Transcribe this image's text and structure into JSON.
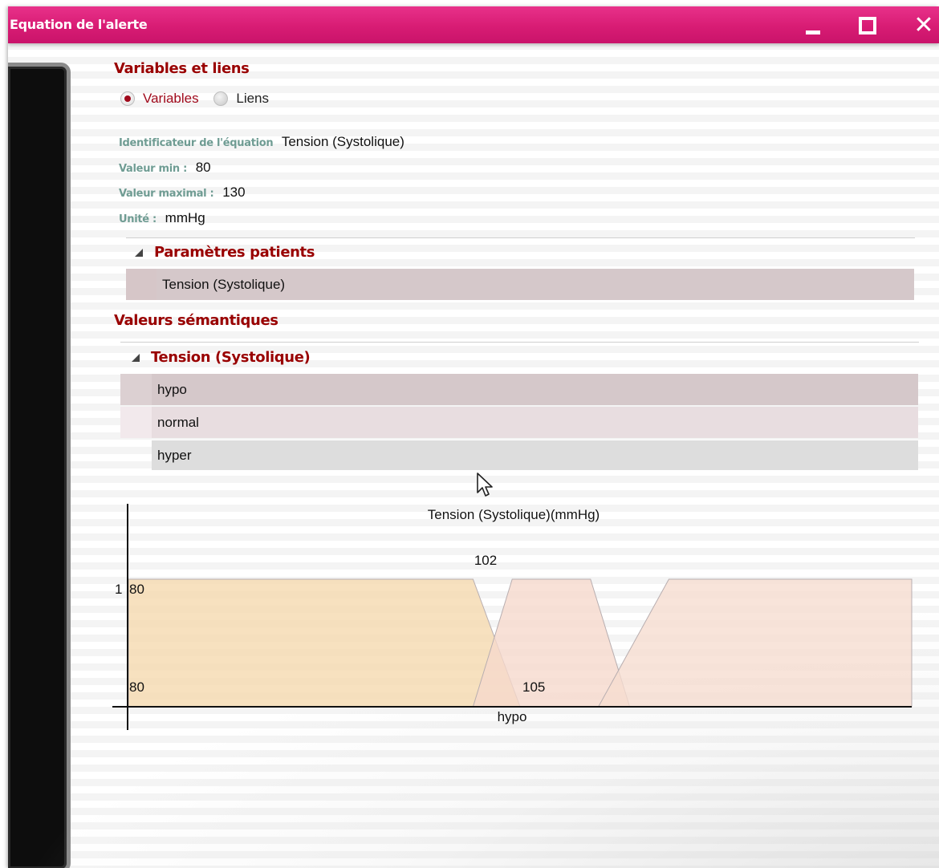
{
  "window": {
    "title": "Equation de l'alerte",
    "minimize_icon": "minimize-icon",
    "maximize_icon": "maximize-icon",
    "close_icon": "close-icon",
    "close_glyph": "✕",
    "titlebar_color": "#d81c74"
  },
  "variables_section": {
    "title": "Variables et liens",
    "radios": [
      {
        "label": "Variables",
        "checked": true
      },
      {
        "label": "Liens",
        "checked": false
      }
    ]
  },
  "fields": {
    "identifier_label": "Identificateur de l'équation",
    "identifier_value": "Tension (Systolique)",
    "min_label": "Valeur min :",
    "min_value": "80",
    "max_label": "Valeur maximal :",
    "max_value": "130",
    "unit_label": "Unité :",
    "unit_value": "mmHg"
  },
  "patient_params": {
    "title": "Paramètres patients",
    "items": [
      "Tension (Systolique)"
    ]
  },
  "semantic_section": {
    "title": "Valeurs sémantiques",
    "group_title": "Tension (Systolique)",
    "items": [
      "hypo",
      "normal",
      "hyper"
    ]
  },
  "chart_data": {
    "type": "area",
    "title": "Tension (Systolique)(mmHg)",
    "x_range": [
      80,
      130
    ],
    "y_range": [
      0,
      1
    ],
    "y_tick_label": "1",
    "series": [
      {
        "points": [
          [
            80,
            1
          ],
          [
            102,
            1
          ],
          [
            105,
            0
          ]
        ],
        "color": "#f5d9ad"
      },
      {
        "points": [
          [
            102,
            0
          ],
          [
            104.5,
            1
          ],
          [
            109.5,
            1
          ],
          [
            112,
            0
          ]
        ],
        "color": "#f6d8cc"
      },
      {
        "points": [
          [
            110,
            0
          ],
          [
            114.5,
            1
          ],
          [
            130,
            1
          ],
          [
            130,
            0
          ]
        ],
        "color": "#f6dccf"
      }
    ],
    "annotations": {
      "top_left": "80",
      "top_center": "102",
      "bottom_left": "80",
      "bottom_center": "105",
      "x_label": "hypo"
    }
  }
}
